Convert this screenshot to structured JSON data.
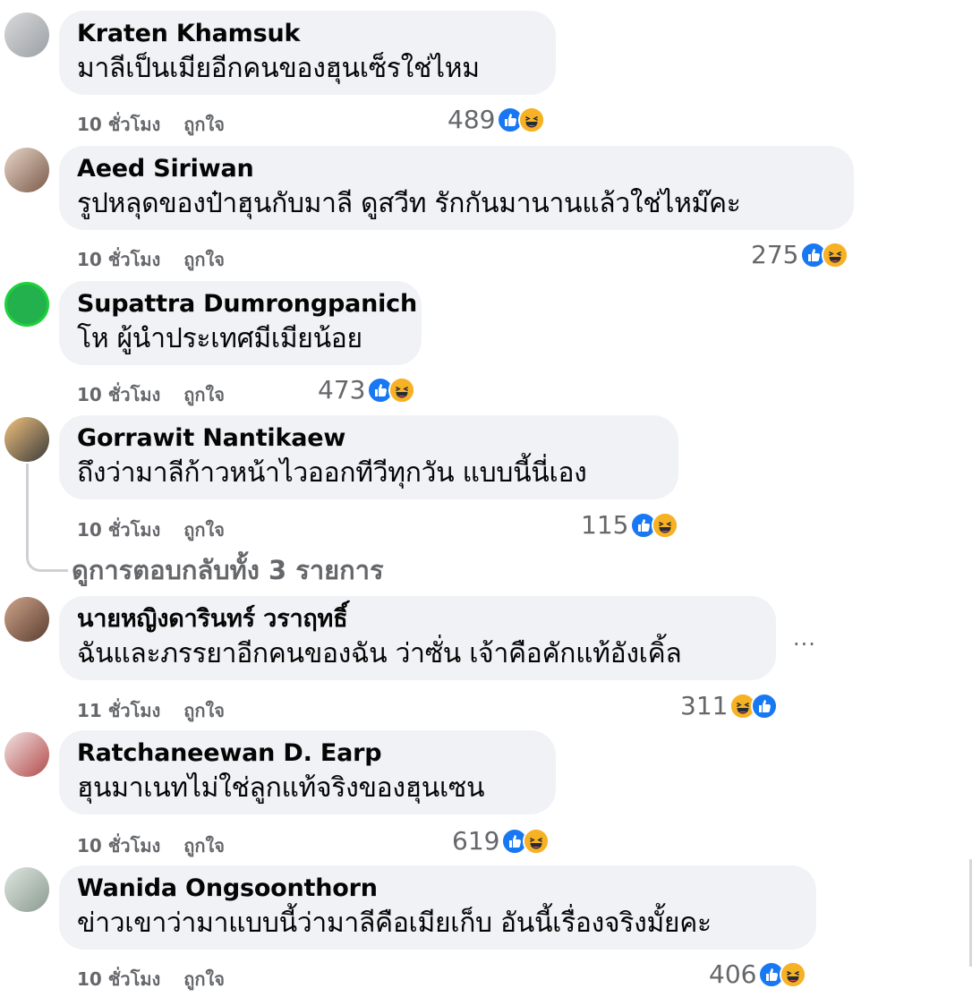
{
  "comments": [
    {
      "name": "Kraten Khamsuk",
      "text": "มาลีเป็นเมียอีกคนของฮุนเซ็รใช่ไหม",
      "time": "10 ชั่วโมง",
      "like": "ถูกใจ",
      "count": "489",
      "reactions": [
        "like-icon",
        "haha-icon"
      ]
    },
    {
      "name": "Aeed Siriwan",
      "text": "รูปหลุดของป๋าฮุนกับมาลี ดูสวีท รักกันมานานแล้วใช่ไหม๊คะ",
      "time": "10 ชั่วโมง",
      "like": "ถูกใจ",
      "count": "275",
      "reactions": [
        "like-icon",
        "haha-icon"
      ]
    },
    {
      "name": "Supattra Dumrongpanich",
      "text": "โห ผู้นำประเทศมีเมียน้อย",
      "time": "10 ชั่วโมง",
      "like": "ถูกใจ",
      "count": "473",
      "reactions": [
        "like-icon",
        "haha-icon"
      ]
    },
    {
      "name": "Gorrawit Nantikaew",
      "text": "ถึงว่ามาลีก้าวหน้าไวออกทีวีทุกวัน แบบนี้นี่เอง",
      "time": "10 ชั่วโมง",
      "like": "ถูกใจ",
      "count": "115",
      "reactions": [
        "like-icon",
        "haha-icon"
      ]
    },
    {
      "name": "นายหญิงดารินทร์ วราฤทธิ์",
      "text": "ฉันและภรรยาอีกคนของฉัน ว่าซั่น เจ้าคือคักแท้อังเคิ้ล",
      "time": "11 ชั่วโมง",
      "like": "ถูกใจ",
      "count": "311",
      "reactions": [
        "haha-icon",
        "like-icon"
      ]
    },
    {
      "name": "Ratchaneewan D. Earp",
      "text": "ฮุนมาเนทไม่ใช่ลูกแท้จริงของฮุนเซน",
      "time": "10 ชั่วโมง",
      "like": "ถูกใจ",
      "count": "619",
      "reactions": [
        "like-icon",
        "haha-icon"
      ]
    },
    {
      "name": "Wanida Ongsoonthorn",
      "text": "ข่าวเขาว่ามาแบบนี้ว่ามาลีคือเมียเก็บ อันนี้เรื่องจริงมั้ยคะ",
      "time": "10 ชั่วโมง",
      "like": "ถูกใจ",
      "count": "406",
      "reactions": [
        "like-icon",
        "haha-icon"
      ]
    }
  ],
  "view_replies": "ดูการตอบกลับทั้ง 3 รายการ",
  "more_label": "···",
  "colors": {
    "bubble": "#f0f2f5",
    "like_blue": "#1877f2",
    "haha_yellow": "#f7b125",
    "meta_gray": "#65676b"
  }
}
